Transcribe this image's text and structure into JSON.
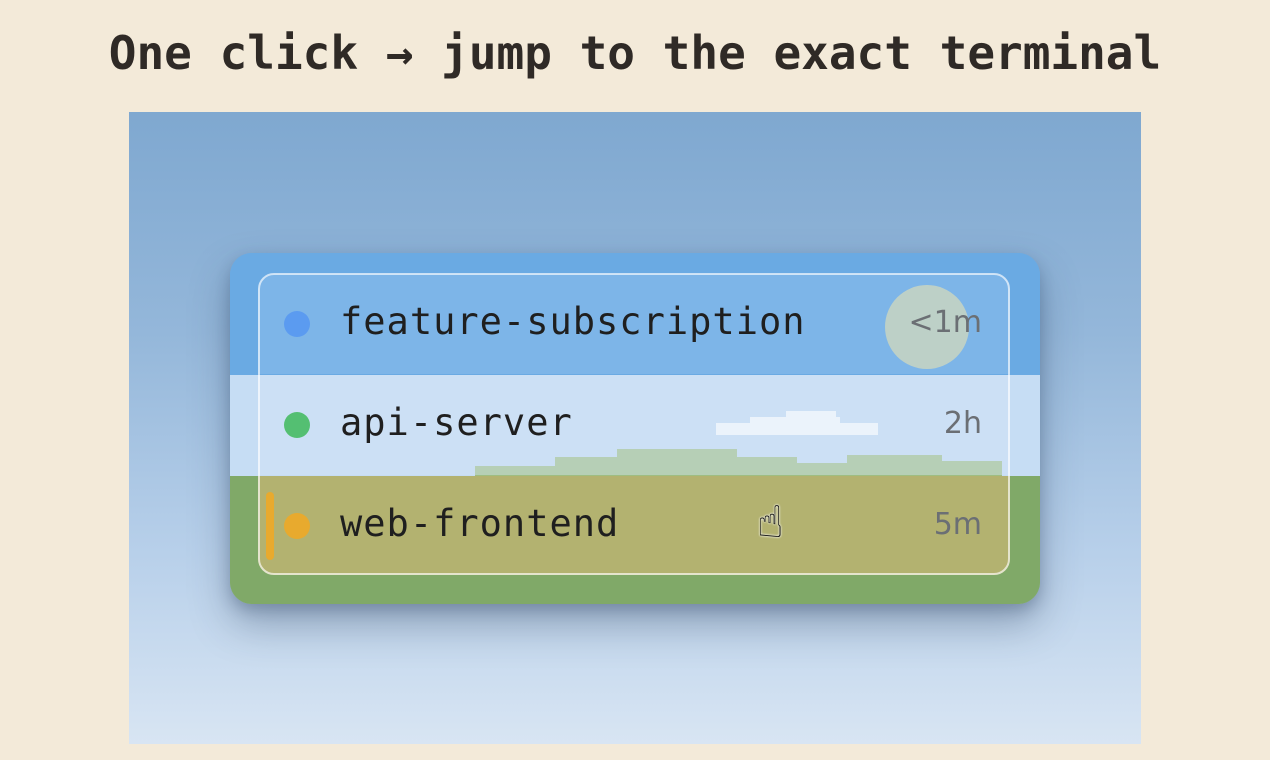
{
  "headline": "One click → jump to the exact terminal",
  "sessions": [
    {
      "name": "feature-subscription",
      "age": "<1m",
      "status_color": "#5b9bf0"
    },
    {
      "name": "api-server",
      "age": "2h",
      "status_color": "#54bf72"
    },
    {
      "name": "web-frontend",
      "age": "5m",
      "status_color": "#e8aa2e"
    }
  ],
  "cursor_icon": "pointing-hand-cursor"
}
